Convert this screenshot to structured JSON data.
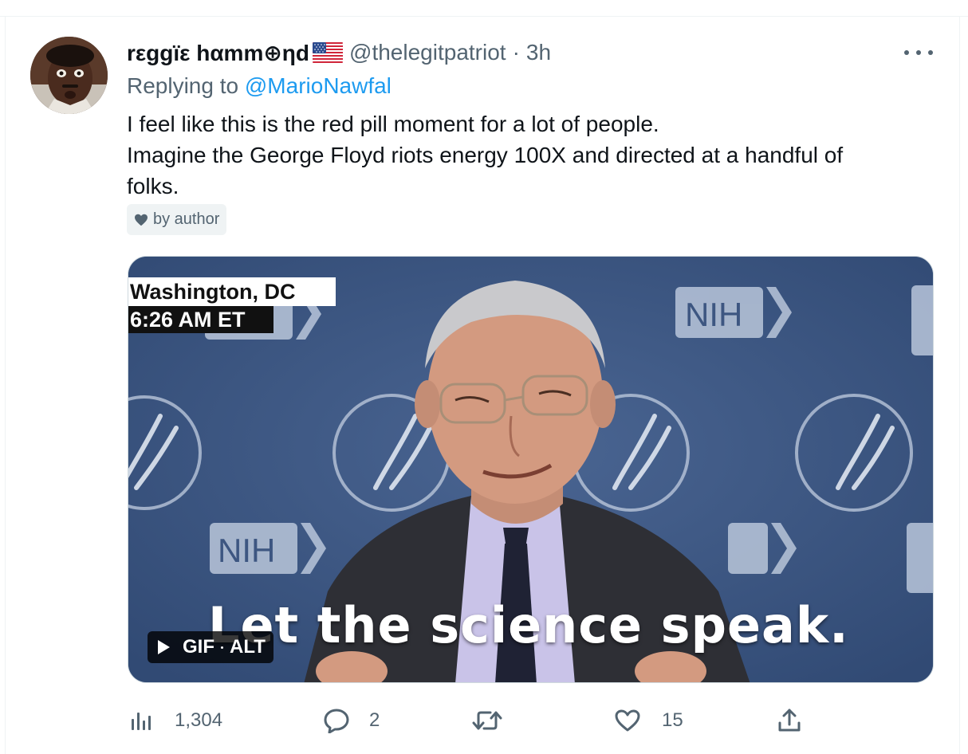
{
  "tweet": {
    "author": {
      "display_name": "rεggïε hαmm⊕ηd",
      "flag_icon": "us-flag-icon",
      "handle": "@thelegitpatriot",
      "separator": "·",
      "time": "3h"
    },
    "reply": {
      "prefix": "Replying to ",
      "mention": "@MarioNawfal"
    },
    "text_lines": [
      "I feel like this is the red pill moment for a lot of people.",
      "Imagine the George Floyd riots energy 100X and directed at a handful of",
      "folks."
    ],
    "liked_by": "by author",
    "media": {
      "location_label": "Washington, DC",
      "time_label": "6:26 AM ET",
      "caption": "Let the science speak.",
      "backdrop_logo": "NIH",
      "gif_label": "GIF",
      "alt_label": "ALT"
    },
    "metrics": {
      "views": "1,304",
      "replies": "2",
      "retweets": "",
      "likes": "15"
    }
  },
  "colors": {
    "text": "#0f1419",
    "muted": "#536471",
    "link": "#1d9bf0",
    "media_bg": "#3d5681"
  }
}
